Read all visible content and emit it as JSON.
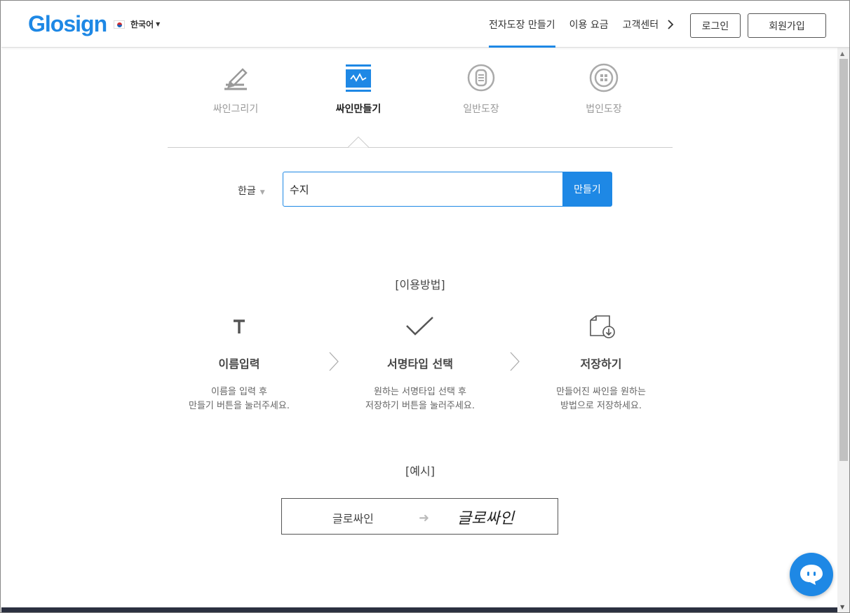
{
  "header": {
    "logo": "Glosign",
    "language": "한국어",
    "nav": [
      {
        "label": "전자도장 만들기",
        "active": true
      },
      {
        "label": "이용 요금",
        "active": false
      },
      {
        "label": "고객센터",
        "active": false
      }
    ],
    "login_label": "로그인",
    "join_label": "회원가입"
  },
  "tabs": [
    {
      "label": "싸인그리기",
      "icon": "pen-draw-icon",
      "active": false
    },
    {
      "label": "싸인만들기",
      "icon": "signature-create-icon",
      "active": true
    },
    {
      "label": "일반도장",
      "icon": "general-stamp-icon",
      "active": false
    },
    {
      "label": "법인도장",
      "icon": "corporate-stamp-icon",
      "active": false
    }
  ],
  "form": {
    "language_select": "한글",
    "name_value": "수지",
    "make_label": "만들기"
  },
  "howto": {
    "title": "[이용방법]",
    "steps": [
      {
        "icon": "text-t-icon",
        "title": "이름입력",
        "desc1": "이름을 입력 후",
        "desc2": "만들기 버튼을 눌러주세요."
      },
      {
        "icon": "checkmark-icon",
        "title": "서명타입 선택",
        "desc1": "원하는 서명타입 선택 후",
        "desc2": "저장하기 버튼을 눌러주세요."
      },
      {
        "icon": "download-doc-icon",
        "title": "저장하기",
        "desc1": "만들어진 싸인을 원하는",
        "desc2": "방법으로 저장하세요."
      }
    ]
  },
  "example": {
    "title": "[예시]",
    "plain": "글로싸인",
    "signature": "글로싸인"
  },
  "colors": {
    "accent": "#1e88e5",
    "footer": "#2b3040"
  }
}
